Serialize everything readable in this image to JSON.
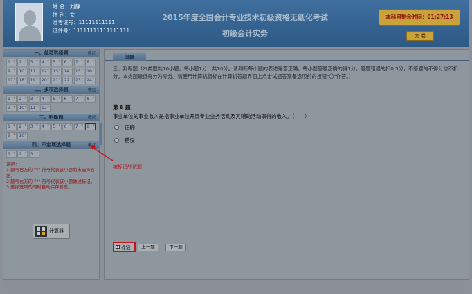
{
  "candidate": {
    "name": "姓 名：刘静",
    "gender": "性 别：女",
    "admission_no": "准考证号：11111111111",
    "id_no": "证件号：11111111111111111"
  },
  "exam": {
    "title": "2015年度全国会计专业技术初级资格无纸化考试",
    "subject": "初级会计实务"
  },
  "timer": {
    "label": "本科目剩余时间：01:27:13"
  },
  "submit": {
    "label": "交 卷"
  },
  "sidebar": {
    "fold_label": "收起",
    "sections": [
      {
        "title": "一、单项选择题",
        "count": 24
      },
      {
        "title": "二、多项选择题",
        "count": 12
      },
      {
        "title": "三、判断题",
        "count": 10,
        "marked": 8
      },
      {
        "title": "四、不定项选择题",
        "count": 3
      }
    ],
    "unanswered_mark": "*",
    "marked_mark": "?",
    "notes": [
      "说明：",
      "1.题号右方的 \"*\" 符号代表该小题尚未选择答案。",
      "2.题号右方的 \"?\" 符号代表该小题做过标记。",
      "3.选择选项的同时自动保存答案。"
    ],
    "calculator": "计算器"
  },
  "content": {
    "tab": "试题",
    "instruction": "三、判断题（本类题共10小题，每小题1分，共10分。请判断每小题的表述是否正确。每小题答题正确的得1分，答题错误的扣0.5分，不答题的不得分也不扣分。本类题最低得分为零分。请使用计算机鼠标在计算机答题界面上点击试题答案备选项前的按钮\"〇\"作答。）",
    "question_number": "第 8 题",
    "question_text": "事业单位的事业收入是指事业单位开展专业业务活动及其辅助活动取得的收入。（　　）",
    "options": [
      "正确",
      "错误"
    ],
    "mark_label": "标记",
    "prev_label": "上一题",
    "next_label": "下一题"
  },
  "callout": {
    "text": "被标记的试题"
  }
}
